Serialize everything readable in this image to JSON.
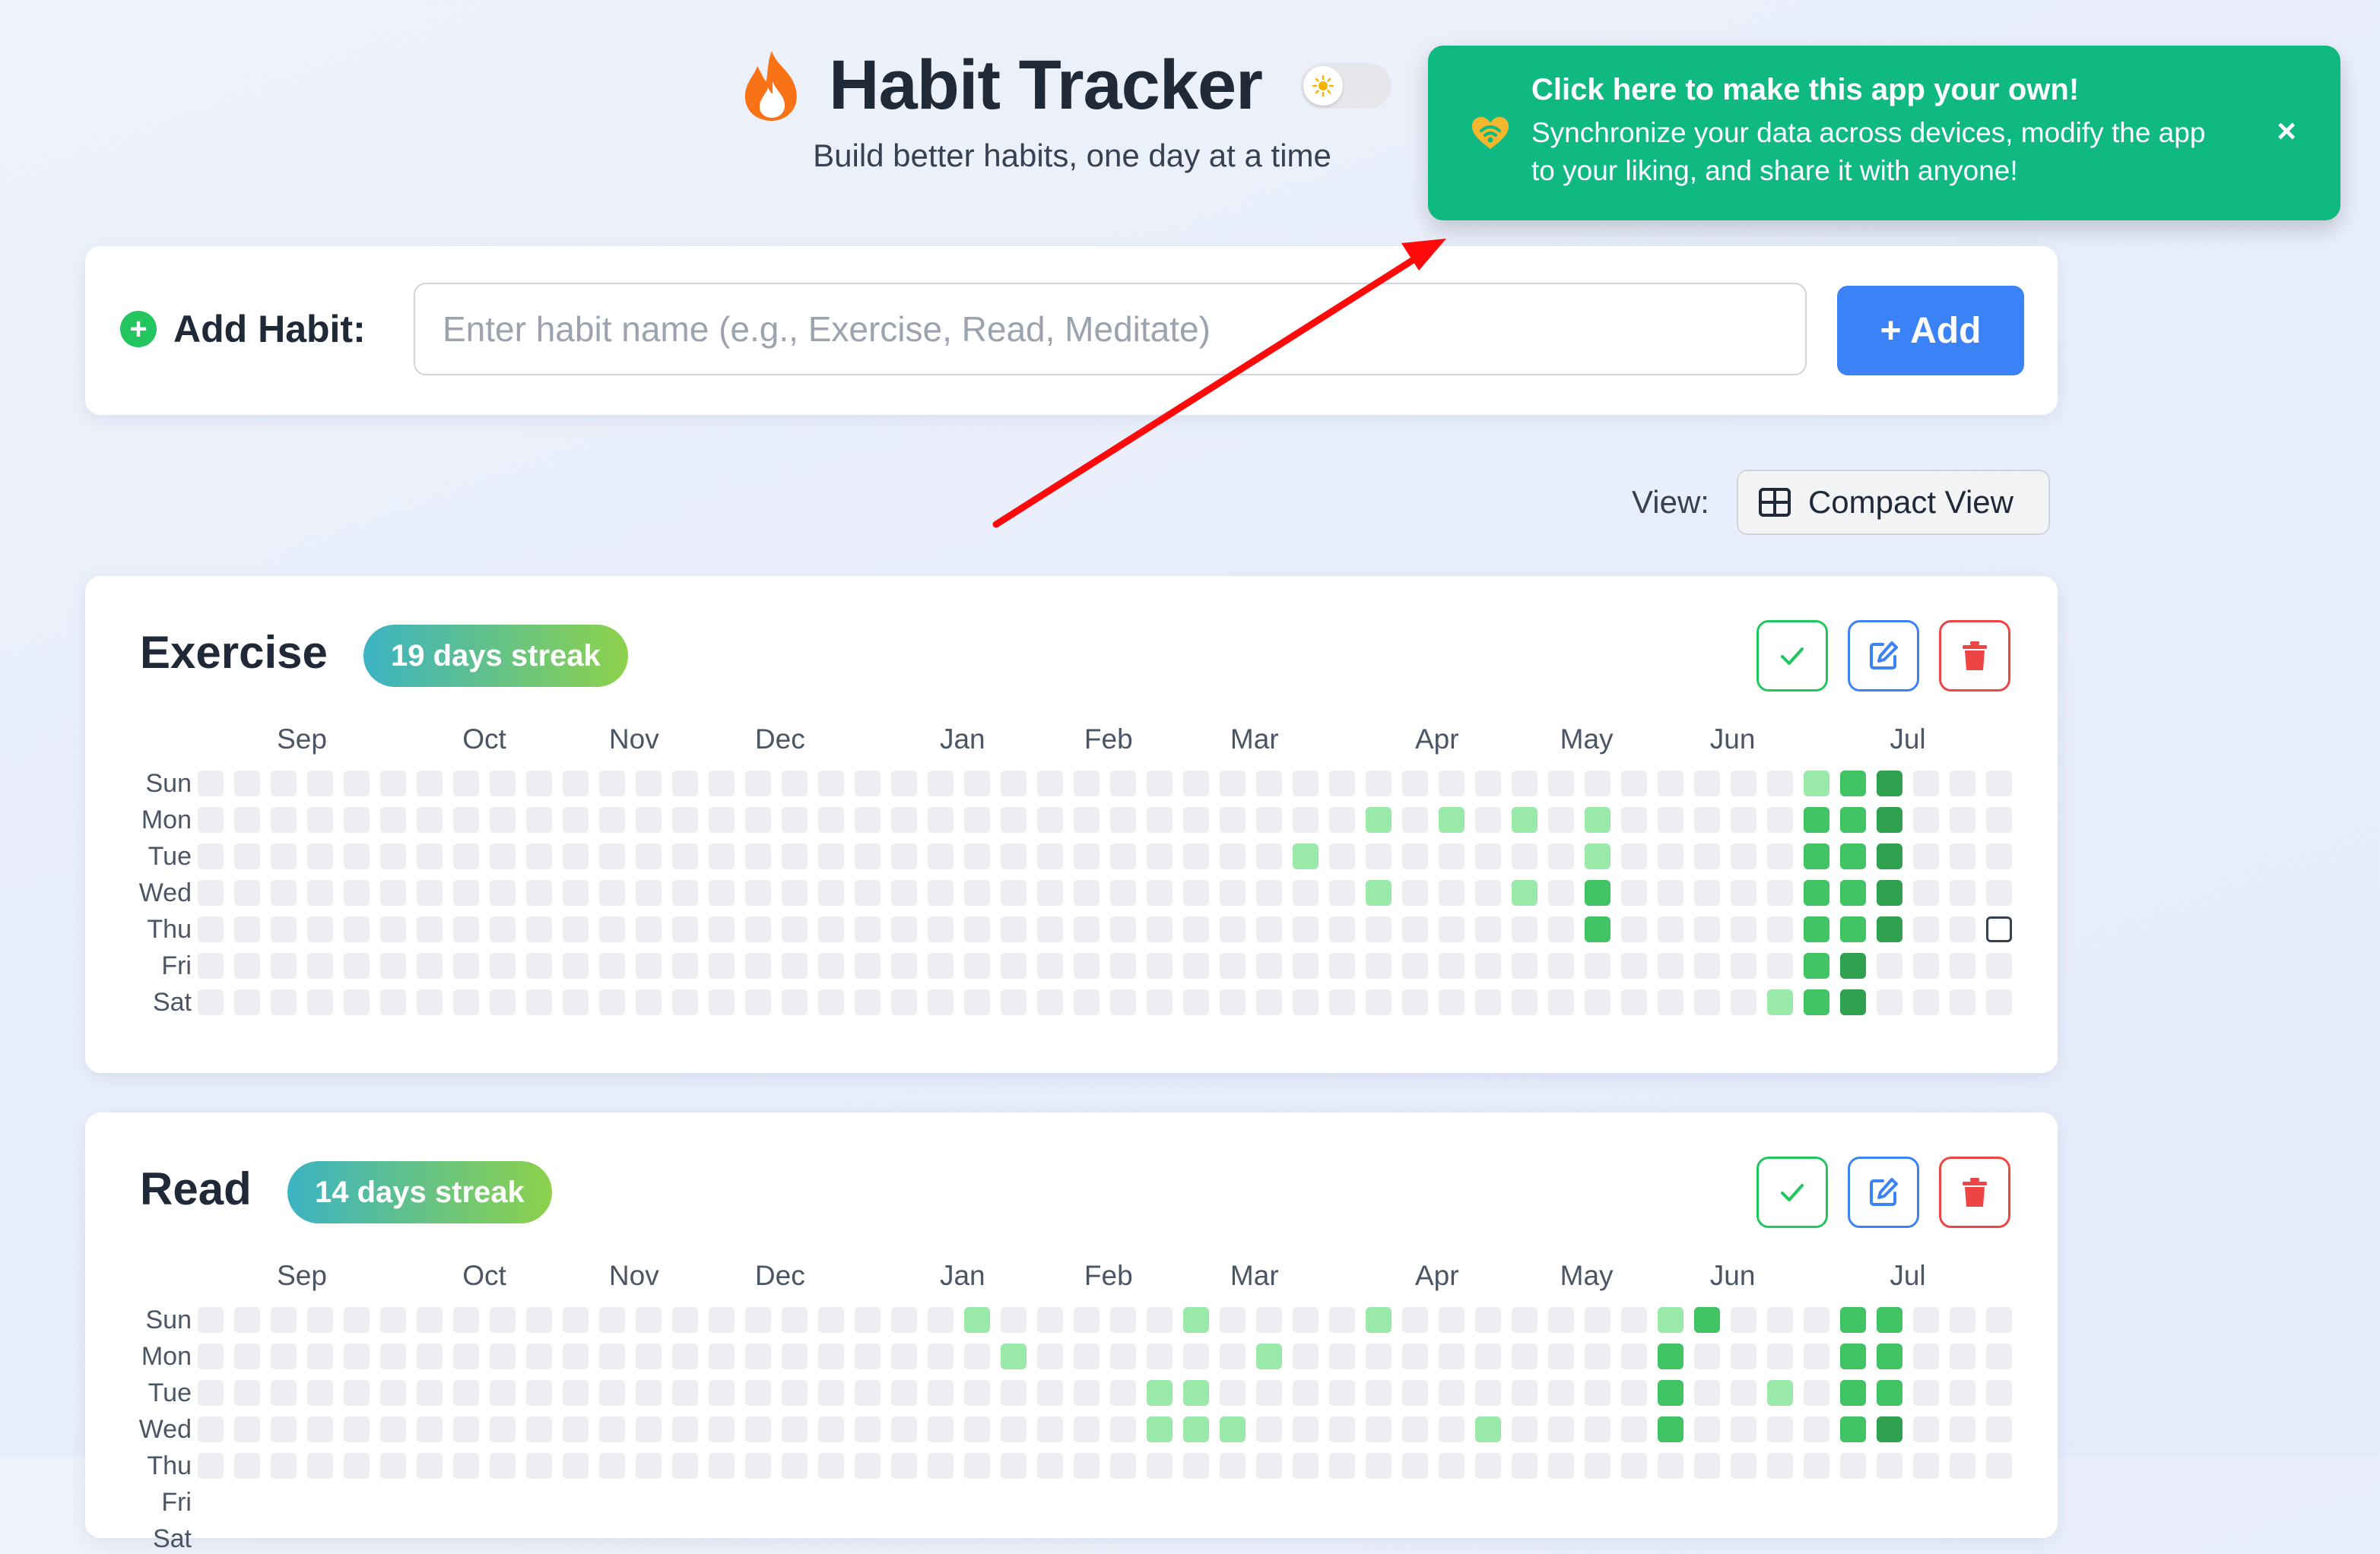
{
  "header": {
    "title": "Habit Tracker",
    "subtitle": "Build better habits, one day at a time",
    "flame_icon": "flame-icon",
    "theme_toggle_icon": "sun-icon"
  },
  "toast": {
    "title": "Click here to make this app your own!",
    "body": "Synchronize your data across devices, modify the app to your liking, and share it with anyone!",
    "close_label": "×",
    "color": "#10b981"
  },
  "add_habit": {
    "label": "Add Habit:",
    "input_value": "",
    "placeholder": "Enter habit name (e.g., Exercise, Read, Meditate)",
    "button_label": "+ Add",
    "button_color": "#3b82f6"
  },
  "view": {
    "label": "View:",
    "button_label": "Compact View"
  },
  "calendar": {
    "weeks": 50,
    "months": [
      {
        "label": "Sep",
        "week": 2.5
      },
      {
        "label": "Oct",
        "week": 7.5
      },
      {
        "label": "Nov",
        "week": 11.6
      },
      {
        "label": "Dec",
        "week": 15.6
      },
      {
        "label": "Jan",
        "week": 20.6
      },
      {
        "label": "Feb",
        "week": 24.6
      },
      {
        "label": "Mar",
        "week": 28.6
      },
      {
        "label": "Apr",
        "week": 33.6
      },
      {
        "label": "May",
        "week": 37.7
      },
      {
        "label": "Jun",
        "week": 41.7
      },
      {
        "label": "Jul",
        "week": 46.5
      }
    ],
    "days": [
      "Sun",
      "Mon",
      "Tue",
      "Wed",
      "Thu",
      "Fri",
      "Sat"
    ],
    "colors": {
      "empty": "#ebedf0",
      "l1": "#9be9a8",
      "l2": "#40c463",
      "l3": "#30a14e"
    }
  },
  "habits": [
    {
      "name": "Exercise",
      "streak": "19 days streak",
      "today": [
        49,
        4
      ],
      "filled": [
        [
          32,
          1,
          1
        ],
        [
          34,
          1,
          1
        ],
        [
          36,
          1,
          1
        ],
        [
          38,
          1,
          1
        ],
        [
          30,
          2,
          1
        ],
        [
          38,
          2,
          1
        ],
        [
          32,
          3,
          1
        ],
        [
          36,
          3,
          1
        ],
        [
          38,
          3,
          2
        ],
        [
          38,
          4,
          2
        ],
        [
          44,
          0,
          1
        ],
        [
          44,
          1,
          2
        ],
        [
          44,
          2,
          2
        ],
        [
          44,
          3,
          2
        ],
        [
          44,
          4,
          2
        ],
        [
          44,
          5,
          2
        ],
        [
          44,
          6,
          2
        ],
        [
          43,
          6,
          1
        ],
        [
          45,
          0,
          2
        ],
        [
          45,
          1,
          2
        ],
        [
          45,
          2,
          2
        ],
        [
          45,
          3,
          2
        ],
        [
          45,
          4,
          2
        ],
        [
          45,
          5,
          3
        ],
        [
          45,
          6,
          3
        ],
        [
          46,
          0,
          3
        ],
        [
          46,
          1,
          3
        ],
        [
          46,
          2,
          3
        ],
        [
          46,
          3,
          3
        ],
        [
          46,
          4,
          3
        ]
      ]
    },
    {
      "name": "Read",
      "streak": "14 days streak",
      "today": null,
      "filled": [
        [
          21,
          0,
          1
        ],
        [
          22,
          1,
          1
        ],
        [
          26,
          2,
          1
        ],
        [
          26,
          3,
          1
        ],
        [
          27,
          0,
          1
        ],
        [
          27,
          2,
          1
        ],
        [
          27,
          3,
          1
        ],
        [
          29,
          1,
          1
        ],
        [
          28,
          3,
          1
        ],
        [
          32,
          0,
          1
        ],
        [
          35,
          3,
          1
        ],
        [
          40,
          0,
          1
        ],
        [
          40,
          1,
          2
        ],
        [
          40,
          2,
          2
        ],
        [
          40,
          3,
          2
        ],
        [
          41,
          0,
          2
        ],
        [
          43,
          2,
          1
        ],
        [
          45,
          0,
          2
        ],
        [
          45,
          1,
          2
        ],
        [
          45,
          2,
          2
        ],
        [
          45,
          3,
          2
        ],
        [
          46,
          0,
          2
        ],
        [
          46,
          1,
          2
        ],
        [
          46,
          2,
          2
        ],
        [
          46,
          3,
          3
        ]
      ]
    }
  ]
}
